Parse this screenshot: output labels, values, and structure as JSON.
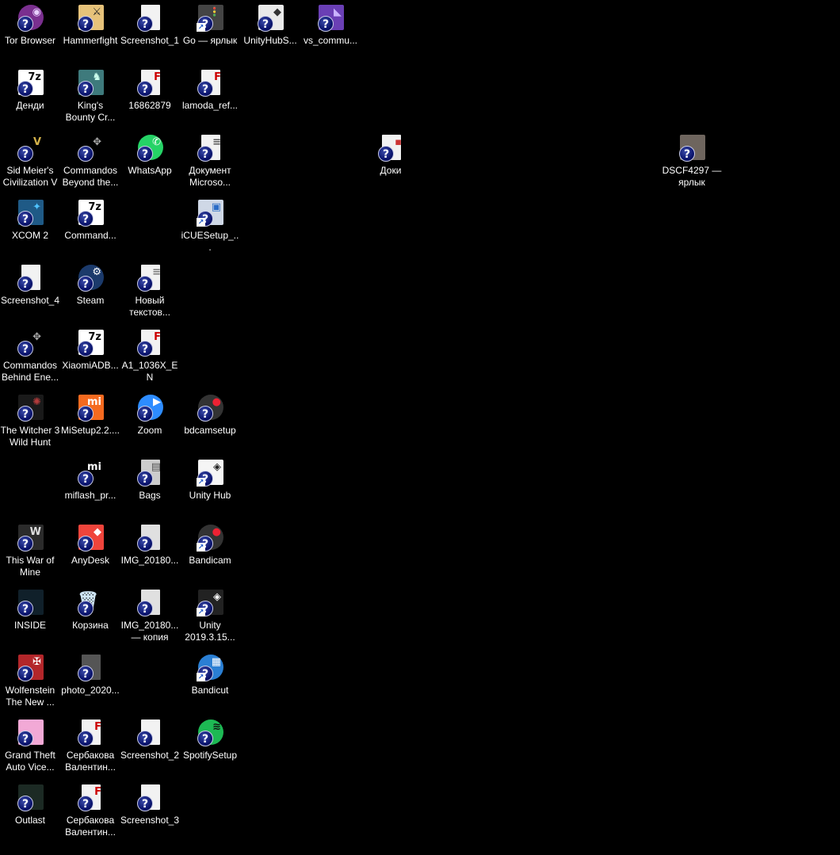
{
  "desktop": {
    "icons": [
      {
        "label": "Tor Browser",
        "icon": "tor-browser-icon",
        "bg": "#7a2f8f",
        "shape": "circle",
        "glyph": "◉",
        "glyph_color": "#e8d0ff"
      },
      {
        "label": "Hammerfight",
        "icon": "hammerfight-icon",
        "bg": "#e6c27a",
        "shape": "sq",
        "glyph": "⚔",
        "glyph_color": "#222"
      },
      {
        "label": "Screenshot_1",
        "icon": "image-file-icon",
        "bg": "#f2f2f2",
        "shape": "doc",
        "glyph": "",
        "glyph_color": "#000"
      },
      {
        "label": "Go — ярлык",
        "icon": "go-shortcut-icon",
        "bg": "#444",
        "shape": "sq",
        "glyph": "🚦",
        "glyph_color": "#f33"
      },
      {
        "label": "UnityHubS...",
        "icon": "unity-hub-setup-icon",
        "bg": "#eaeaea",
        "shape": "sq",
        "glyph": "◆",
        "glyph_color": "#333"
      },
      {
        "label": "vs_commu...",
        "icon": "visual-studio-installer-icon",
        "bg": "#6a3fb5",
        "shape": "sq",
        "glyph": "◣",
        "glyph_color": "#c9b3ff"
      },
      {
        "label": "Денди",
        "icon": "7z-archive-icon",
        "bg": "#ffffff",
        "shape": "sq",
        "glyph": "7z",
        "glyph_color": "#000"
      },
      {
        "label": "King's\nBounty Cr...",
        "icon": "kings-bounty-icon",
        "bg": "#3e7a7c",
        "shape": "sq",
        "glyph": "♞",
        "glyph_color": "#cfe"
      },
      {
        "label": "16862879",
        "icon": "pdf-file-icon",
        "bg": "#f2f2f2",
        "shape": "doc",
        "glyph": "F",
        "glyph_color": "#c00"
      },
      {
        "label": "lamoda_ref...",
        "icon": "pdf-file-icon",
        "bg": "#f2f2f2",
        "shape": "doc",
        "glyph": "F",
        "glyph_color": "#c00"
      },
      {
        "label": "Sid Meier's\nCivilization V",
        "icon": "civilization-v-icon",
        "bg": "#000",
        "shape": "sq",
        "glyph": "V",
        "glyph_color": "#d4b24a"
      },
      {
        "label": "Commandos\nBeyond the...",
        "icon": "commandos-beyond-icon",
        "bg": "#000",
        "shape": "sq",
        "glyph": "✥",
        "glyph_color": "#aaa"
      },
      {
        "label": "WhatsApp",
        "icon": "whatsapp-icon",
        "bg": "#25d366",
        "shape": "circle",
        "glyph": "✆",
        "glyph_color": "#fff"
      },
      {
        "label": "Документ\nMicroso...",
        "icon": "word-document-icon",
        "bg": "#f2f2f2",
        "shape": "doc",
        "glyph": "≡",
        "glyph_color": "#555"
      },
      {
        "label": "Доки",
        "icon": "document-file-icon",
        "bg": "#f2f2f2",
        "shape": "doc",
        "glyph": "▪",
        "glyph_color": "#c33"
      },
      {
        "label": "DSCF4297 —\nярлык",
        "icon": "photo-shortcut-icon",
        "bg": "#6e655e",
        "shape": "sq",
        "glyph": "",
        "glyph_color": "#000"
      },
      {
        "label": "XCOM 2",
        "icon": "xcom2-icon",
        "bg": "#1f5a86",
        "shape": "sq",
        "glyph": "✦",
        "glyph_color": "#4fc3ff"
      },
      {
        "label": "Command...",
        "icon": "7z-archive-icon",
        "bg": "#ffffff",
        "shape": "sq",
        "glyph": "7z",
        "glyph_color": "#000"
      },
      {
        "label": "iCUESetup_...",
        "icon": "icue-setup-icon",
        "bg": "#cfd8e6",
        "shape": "sq",
        "glyph": "▣",
        "glyph_color": "#2a6cc7"
      },
      {
        "label": "Screenshot_4",
        "icon": "image-file-icon",
        "bg": "#f2f2f2",
        "shape": "doc",
        "glyph": "",
        "glyph_color": "#000"
      },
      {
        "label": "Steam",
        "icon": "steam-icon",
        "bg": "#1b3a6b",
        "shape": "circle",
        "glyph": "⚙",
        "glyph_color": "#fff"
      },
      {
        "label": "Новый\nтекстов...",
        "icon": "text-file-icon",
        "bg": "#f2f2f2",
        "shape": "doc",
        "glyph": "≡",
        "glyph_color": "#777"
      },
      {
        "label": "Commandos\nBehind Ene...",
        "icon": "commandos-behind-icon",
        "bg": "#000",
        "shape": "sq",
        "glyph": "✥",
        "glyph_color": "#aaa"
      },
      {
        "label": "XiaomiADB...",
        "icon": "7z-archive-icon",
        "bg": "#ffffff",
        "shape": "sq",
        "glyph": "7z",
        "glyph_color": "#000"
      },
      {
        "label": "A1_1036X_EN",
        "icon": "pdf-file-icon",
        "bg": "#f2f2f2",
        "shape": "doc",
        "glyph": "F",
        "glyph_color": "#c00"
      },
      {
        "label": "The Witcher 3\nWild Hunt",
        "icon": "witcher3-icon",
        "bg": "#1a1a1a",
        "shape": "sq",
        "glyph": "✺",
        "glyph_color": "#b43c3c"
      },
      {
        "label": "MiSetup2.2....",
        "icon": "mi-setup-icon",
        "bg": "#f56a1f",
        "shape": "sq",
        "glyph": "mi",
        "glyph_color": "#fff"
      },
      {
        "label": "Zoom",
        "icon": "zoom-icon",
        "bg": "#2d8cff",
        "shape": "circle",
        "glyph": "▶",
        "glyph_color": "#fff"
      },
      {
        "label": "bdcamsetup",
        "icon": "bandicam-setup-icon",
        "bg": "#333",
        "shape": "circle",
        "glyph": "●",
        "glyph_color": "#e23"
      },
      {
        "label": "miflash_pr...",
        "icon": "miflash-icon",
        "bg": "#000",
        "shape": "sq",
        "glyph": "mi",
        "glyph_color": "#fff"
      },
      {
        "label": "Bags",
        "icon": "bags-icon",
        "bg": "#cccccc",
        "shape": "doc",
        "glyph": "▤",
        "glyph_color": "#555"
      },
      {
        "label": "Unity Hub",
        "icon": "unity-hub-icon",
        "bg": "#f5f5f5",
        "shape": "sq",
        "glyph": "◈",
        "glyph_color": "#222"
      },
      {
        "label": "This War of\nMine",
        "icon": "this-war-of-mine-icon",
        "bg": "#2b2b2b",
        "shape": "sq",
        "glyph": "W",
        "glyph_color": "#ddd"
      },
      {
        "label": "AnyDesk",
        "icon": "anydesk-icon",
        "bg": "#ef443b",
        "shape": "sq",
        "glyph": "◆",
        "glyph_color": "#fff"
      },
      {
        "label": "IMG_20180...",
        "icon": "image-file-icon",
        "bg": "#e0e0e0",
        "shape": "doc",
        "glyph": "",
        "glyph_color": "#000"
      },
      {
        "label": "Bandicam",
        "icon": "bandicam-icon",
        "bg": "#333",
        "shape": "circle",
        "glyph": "●",
        "glyph_color": "#e23"
      },
      {
        "label": "INSIDE",
        "icon": "inside-icon",
        "bg": "#10202a",
        "shape": "sq",
        "glyph": "",
        "glyph_color": "#000"
      },
      {
        "label": "Корзина",
        "icon": "recycle-bin-icon",
        "bg": "none",
        "shape": "none",
        "glyph": "🗑",
        "glyph_color": "#cfe6f5"
      },
      {
        "label": "IMG_20180...\n— копия",
        "icon": "image-file-icon",
        "bg": "#e0e0e0",
        "shape": "doc",
        "glyph": "",
        "glyph_color": "#000"
      },
      {
        "label": "Unity\n2019.3.15...",
        "icon": "unity-editor-icon",
        "bg": "#222",
        "shape": "sq",
        "glyph": "◈",
        "glyph_color": "#fff"
      },
      {
        "label": "Wolfenstein\nThe New ...",
        "icon": "wolfenstein-icon",
        "bg": "#b3262a",
        "shape": "sq",
        "glyph": "✠",
        "glyph_color": "#fff"
      },
      {
        "label": "photo_2020...",
        "icon": "image-file-icon",
        "bg": "#555",
        "shape": "doc",
        "glyph": "",
        "glyph_color": "#000"
      },
      {
        "label": "Bandicut",
        "icon": "bandicut-icon",
        "bg": "#2a7fd4",
        "shape": "circle",
        "glyph": "▦",
        "glyph_color": "#fff"
      },
      {
        "label": "Grand Theft\nAuto Vice...",
        "icon": "gta-vice-city-icon",
        "bg": "#f2a9d6",
        "shape": "sq",
        "glyph": "",
        "glyph_color": "#000"
      },
      {
        "label": "Сербакова\nВалентин...",
        "icon": "pdf-file-icon",
        "bg": "#f2f2f2",
        "shape": "doc",
        "glyph": "F",
        "glyph_color": "#c00"
      },
      {
        "label": "Screenshot_2",
        "icon": "image-file-icon",
        "bg": "#f2f2f2",
        "shape": "doc",
        "glyph": "",
        "glyph_color": "#000"
      },
      {
        "label": "SpotifySetup",
        "icon": "spotify-setup-icon",
        "bg": "#1db954",
        "shape": "circle",
        "glyph": "≋",
        "glyph_color": "#111"
      },
      {
        "label": "Outlast",
        "icon": "outlast-icon",
        "bg": "#1c2a24",
        "shape": "sq",
        "glyph": "",
        "glyph_color": "#000"
      },
      {
        "label": "Сербакова\nВалентин...",
        "icon": "pdf-file-icon",
        "bg": "#f2f2f2",
        "shape": "doc",
        "glyph": "F",
        "glyph_color": "#c00"
      },
      {
        "label": "Screenshot_3",
        "icon": "image-file-icon",
        "bg": "#f2f2f2",
        "shape": "doc",
        "glyph": "",
        "glyph_color": "#000"
      }
    ]
  }
}
